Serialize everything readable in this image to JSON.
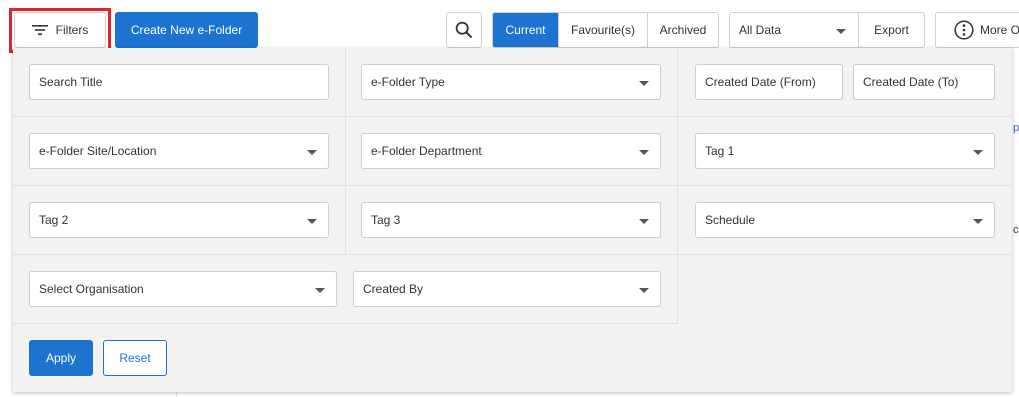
{
  "toolbar": {
    "filters_label": "Filters",
    "create_label": "Create New e-Folder",
    "view_tabs": [
      "Current",
      "Favourite(s)",
      "Archived"
    ],
    "active_view": "Current",
    "data_scope": "All Data",
    "export_label": "Export",
    "more_label": "More Options"
  },
  "filters": {
    "search_title": "Search Title",
    "folder_type": "e-Folder Type",
    "created_from": "Created Date (From)",
    "created_to": "Created Date (To)",
    "site_location": "e-Folder Site/Location",
    "department": "e-Folder Department",
    "tag1": "Tag 1",
    "tag2": "Tag 2",
    "tag3": "Tag 3",
    "schedule": "Schedule",
    "organisation": "Select Organisation",
    "created_by": "Created By",
    "apply_label": "Apply",
    "reset_label": "Reset"
  },
  "background": {
    "right_fragment_1": "p",
    "right_fragment_2": "c"
  },
  "colors": {
    "accent": "#1c73d0",
    "highlight": "#e0232e",
    "panel_bg": "#f3f2f1"
  },
  "icons": {
    "filters": "filter-lines-icon",
    "search": "search-icon",
    "more": "more-vertical-icon"
  }
}
